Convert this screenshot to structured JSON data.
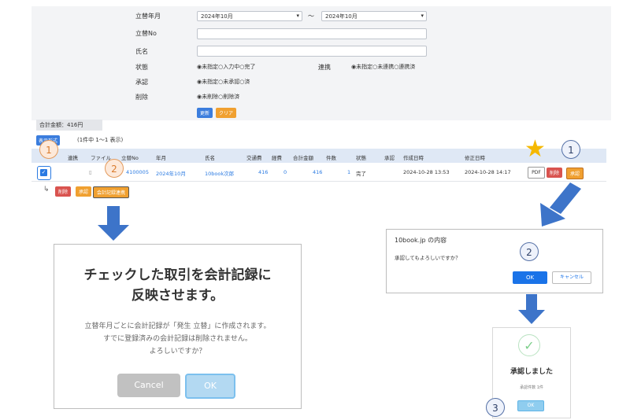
{
  "form": {
    "labels": [
      "立替年月",
      "立替No",
      "氏名",
      "状態",
      "承認",
      "削除"
    ],
    "month_from": "2024年10月",
    "month_to": "2024年10月",
    "range_sep": "～",
    "status_options": "◉未指定○入力中○完了",
    "link_label": "連携",
    "link_options": "◉未指定○未連携○連携済",
    "approve_options": "◉未指定○未承認○済",
    "delete_options": "◉未削除○削除済",
    "update_button": "更新",
    "clear_button": "クリア"
  },
  "summary": {
    "total_label": "合計金額：416円",
    "tab_badge": "表示形式",
    "count_text": "(1件中 1〜1 表示)"
  },
  "table": {
    "headers": [
      "連携",
      "ファイル",
      "立替No",
      "年月",
      "氏名",
      "交通費",
      "経費",
      "合計金額",
      "件数",
      "状態",
      "承認",
      "作成日時",
      "修正日時"
    ],
    "row": {
      "file_icon": "file-icon",
      "no": "4100005",
      "month": "2024年10月",
      "name": "10book次郎",
      "transport": "416",
      "expense": "0",
      "total": "416",
      "count": "1",
      "status": "完了",
      "created": "2024-10-28 13:53",
      "modified": "2024-10-28 14:17",
      "pdf_button": "PDF",
      "delete_button": "削除",
      "approve_button": "承認"
    },
    "bulk": {
      "delete": "削除",
      "approve": "承認",
      "reflect": "会計記録連携"
    }
  },
  "markers": {
    "one_left": "1",
    "two_left": "2",
    "one_right": "1",
    "two_right": "2",
    "three_right": "3"
  },
  "dialog_left": {
    "title_line1": "チェックした取引を会計記録に",
    "title_line2": "反映させます。",
    "body_line1": "立替年月ごとに会計記録が「発生 立替」に作成されます。",
    "body_line2": "すでに登録済みの会計記録は削除されません。",
    "body_line3": "よろしいですか？",
    "cancel": "Cancel",
    "ok": "OK"
  },
  "dialog_confirm": {
    "title": "10book.jp の内容",
    "message": "承認してもよろしいですか？",
    "ok": "OK",
    "cancel": "キャンセル"
  },
  "dialog_done": {
    "title": "承認しました",
    "sub": "承認件数 1件",
    "ok": "OK"
  },
  "colors": {
    "accent": "#3b7ddd",
    "arrow": "#3d74c9",
    "star": "#f5b800"
  }
}
